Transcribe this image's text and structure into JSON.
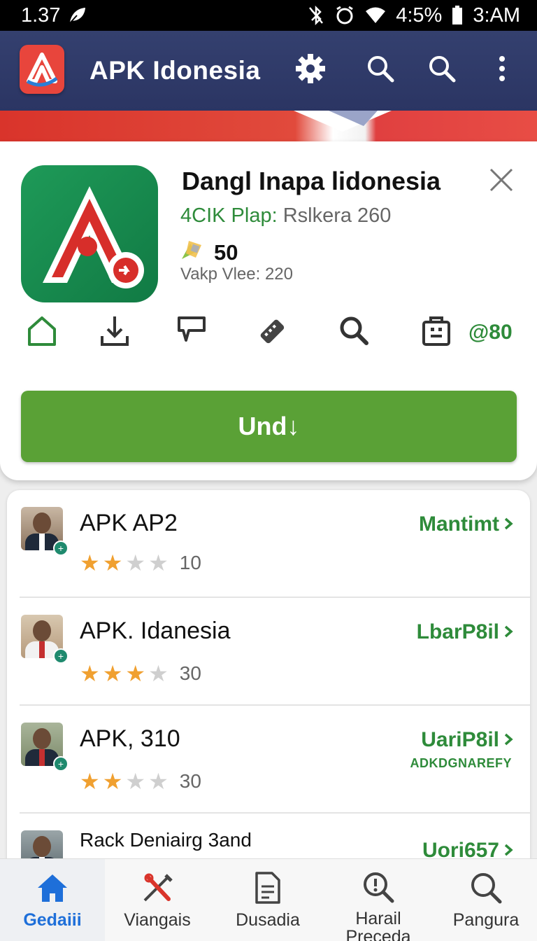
{
  "status_bar": {
    "time": "1.37",
    "battery": "4:5%",
    "clock": "3:AM"
  },
  "app_bar": {
    "title": "APK Idonesia",
    "icons": [
      "settings-icon",
      "search-icon",
      "search-icon",
      "more-vert-icon"
    ]
  },
  "app_card": {
    "title": "Dangl Inapa lidonesia",
    "developer": "4CIK Plap:",
    "developer_rest": " Rslkera 260",
    "rating": "50",
    "meta": "Vakp Vlee: 220",
    "action_icons": [
      "home-icon",
      "download-icon",
      "comment-icon",
      "usb-icon",
      "search-icon",
      "bag-icon"
    ],
    "action_count": "@80",
    "install_label": "Und↓"
  },
  "list": {
    "rows": [
      {
        "title": "APK AP2",
        "stars": 2,
        "count": "10",
        "action": "Mantimt",
        "sub": ""
      },
      {
        "title": "APK. Idanesia",
        "stars": 3,
        "count": "30",
        "action": "LbarP8il",
        "sub": ""
      },
      {
        "title": "APK, 310",
        "stars": 2,
        "count": "30",
        "action": "UariP8il",
        "sub": "ADKDGNAREFY"
      },
      {
        "title": "Rack Deniairg 3and",
        "stars": 0,
        "count": "",
        "action": "Uori657",
        "sub": ""
      }
    ]
  },
  "bottom_nav": {
    "items": [
      {
        "label": "Gedaiii",
        "icon": "home-icon"
      },
      {
        "label": "Viangais",
        "icon": "tools-icon"
      },
      {
        "label": "Dusadia",
        "icon": "document-icon"
      },
      {
        "label": "Harail Preceda",
        "icon": "search-info-icon"
      },
      {
        "label": "Pangura",
        "icon": "search-icon"
      }
    ]
  },
  "colors": {
    "app_bar": "#2f3a69",
    "accent_green": "#5aa136",
    "text_green": "#2e8b3a",
    "star": "#f0a030",
    "active_nav": "#1e6fd9"
  }
}
